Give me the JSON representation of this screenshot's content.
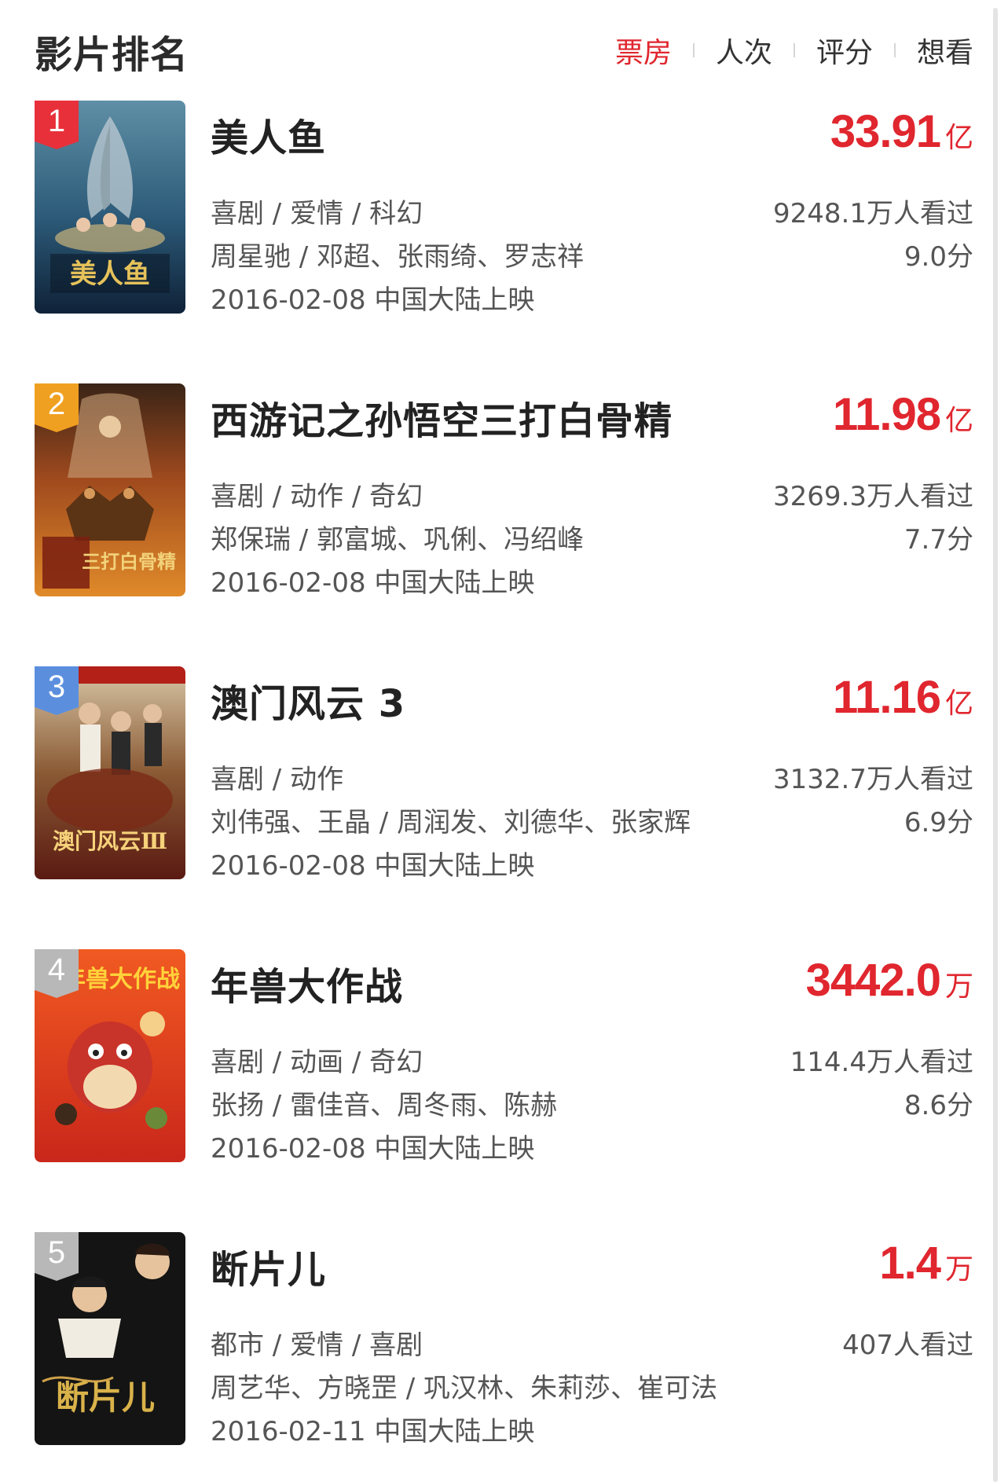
{
  "header": {
    "title": "影片排名",
    "tabs": [
      {
        "label": "票房",
        "active": true
      },
      {
        "label": "人次",
        "active": false
      },
      {
        "label": "评分",
        "active": false
      },
      {
        "label": "想看",
        "active": false
      }
    ]
  },
  "colors": {
    "accent": "#e0262e",
    "rank_1": "#e8303a",
    "rank_2": "#f0a020",
    "rank_3": "#5b8fde",
    "rank_other": "#b8b8b8"
  },
  "movies": [
    {
      "rank": "1",
      "title": "美人鱼",
      "box_value": "33.91",
      "box_unit": "亿",
      "genre": "喜剧 / 爱情 / 科幻",
      "cast": "周星驰 / 邓超、张雨绮、罗志祥",
      "release": "2016-02-08 中国大陆上映",
      "viewers": "9248.1万人看过",
      "score": "9.0分",
      "poster_icon": "mermaid-poster"
    },
    {
      "rank": "2",
      "title": "西游记之孙悟空三打白骨精",
      "box_value": "11.98",
      "box_unit": "亿",
      "genre": "喜剧 / 动作 / 奇幻",
      "cast": "郑保瑞 / 郭富城、巩俐、冯绍峰",
      "release": "2016-02-08 中国大陆上映",
      "viewers": "3269.3万人看过",
      "score": "7.7分",
      "poster_icon": "monkey-king-poster"
    },
    {
      "rank": "3",
      "title": "澳门风云 3",
      "box_value": "11.16",
      "box_unit": "亿",
      "genre": "喜剧 / 动作",
      "cast": "刘伟强、王晶 / 周润发、刘德华、张家辉",
      "release": "2016-02-08 中国大陆上映",
      "viewers": "3132.7万人看过",
      "score": "6.9分",
      "poster_icon": "macau-poster"
    },
    {
      "rank": "4",
      "title": "年兽大作战",
      "box_value": "3442.0",
      "box_unit": "万",
      "genre": "喜剧 / 动画 / 奇幻",
      "cast": "张扬 / 雷佳音、周冬雨、陈赫",
      "release": "2016-02-08 中国大陆上映",
      "viewers": "114.4万人看过",
      "score": "8.6分",
      "poster_icon": "nian-poster"
    },
    {
      "rank": "5",
      "title": "断片儿",
      "box_value": "1.4",
      "box_unit": "万",
      "genre": "都市 / 爱情 / 喜剧",
      "cast": "周艺华、方晓罡 / 巩汉林、朱莉莎、崔可法",
      "release": "2016-02-11 中国大陆上映",
      "viewers": "407人看过",
      "score": "",
      "poster_icon": "duanpian-poster"
    }
  ]
}
